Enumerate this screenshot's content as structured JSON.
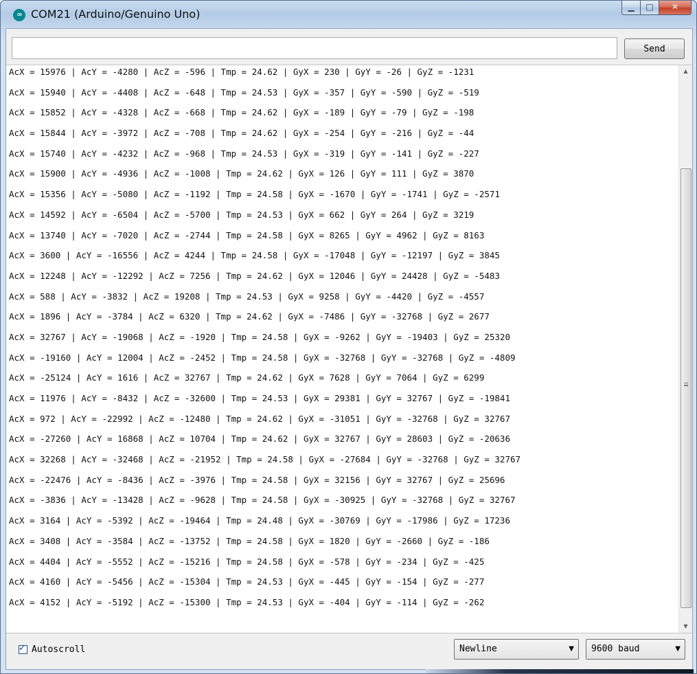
{
  "window": {
    "title": "COM21 (Arduino/Genuino Uno)",
    "app_icon_glyph": "∞",
    "minimize_glyph": "▁",
    "maximize_glyph": "□",
    "close_glyph": "✕"
  },
  "toolbar": {
    "input_value": "",
    "send_label": "Send"
  },
  "output": {
    "lines": [
      "AcX = 15976 | AcY = -4280 | AcZ = -596 | Tmp = 24.62 | GyX = 230 | GyY = -26 | GyZ = -1231",
      "AcX = 15940 | AcY = -4408 | AcZ = -648 | Tmp = 24.53 | GyX = -357 | GyY = -590 | GyZ = -519",
      "AcX = 15852 | AcY = -4328 | AcZ = -668 | Tmp = 24.62 | GyX = -189 | GyY = -79 | GyZ = -198",
      "AcX = 15844 | AcY = -3972 | AcZ = -708 | Tmp = 24.62 | GyX = -254 | GyY = -216 | GyZ = -44",
      "AcX = 15740 | AcY = -4232 | AcZ = -968 | Tmp = 24.53 | GyX = -319 | GyY = -141 | GyZ = -227",
      "AcX = 15900 | AcY = -4936 | AcZ = -1008 | Tmp = 24.62 | GyX = 126 | GyY = 111 | GyZ = 3870",
      "AcX = 15356 | AcY = -5080 | AcZ = -1192 | Tmp = 24.58 | GyX = -1670 | GyY = -1741 | GyZ = -2571",
      "AcX = 14592 | AcY = -6504 | AcZ = -5700 | Tmp = 24.53 | GyX = 662 | GyY = 264 | GyZ = 3219",
      "AcX = 13740 | AcY = -7020 | AcZ = -2744 | Tmp = 24.58 | GyX = 8265 | GyY = 4962 | GyZ = 8163",
      "AcX = 3600 | AcY = -16556 | AcZ = 4244 | Tmp = 24.58 | GyX = -17048 | GyY = -12197 | GyZ = 3845",
      "AcX = 12248 | AcY = -12292 | AcZ = 7256 | Tmp = 24.62 | GyX = 12046 | GyY = 24428 | GyZ = -5483",
      "AcX = 588 | AcY = -3832 | AcZ = 19208 | Tmp = 24.53 | GyX = 9258 | GyY = -4420 | GyZ = -4557",
      "AcX = 1896 | AcY = -3784 | AcZ = 6320 | Tmp = 24.62 | GyX = -7486 | GyY = -32768 | GyZ = 2677",
      "AcX = 32767 | AcY = -19068 | AcZ = -1920 | Tmp = 24.58 | GyX = -9262 | GyY = -19403 | GyZ = 25320",
      "AcX = -19160 | AcY = 12004 | AcZ = -2452 | Tmp = 24.58 | GyX = -32768 | GyY = -32768 | GyZ = -4809",
      "AcX = -25124 | AcY = 1616 | AcZ = 32767 | Tmp = 24.62 | GyX = 7628 | GyY = 7064 | GyZ = 6299",
      "AcX = 11976 | AcY = -8432 | AcZ = -32600 | Tmp = 24.53 | GyX = 29381 | GyY = 32767 | GyZ = -19841",
      "AcX = 972 | AcY = -22992 | AcZ = -12480 | Tmp = 24.62 | GyX = -31051 | GyY = -32768 | GyZ = 32767",
      "AcX = -27260 | AcY = 16868 | AcZ = 10704 | Tmp = 24.62 | GyX = 32767 | GyY = 28603 | GyZ = -20636",
      "AcX = 32268 | AcY = -32468 | AcZ = -21952 | Tmp = 24.58 | GyX = -27684 | GyY = -32768 | GyZ = 32767",
      "AcX = -22476 | AcY = -8436 | AcZ = -3976 | Tmp = 24.58 | GyX = 32156 | GyY = 32767 | GyZ = 25696",
      "AcX = -3836 | AcY = -13428 | AcZ = -9628 | Tmp = 24.58 | GyX = -30925 | GyY = -32768 | GyZ = 32767",
      "AcX = 3164 | AcY = -5392 | AcZ = -19464 | Tmp = 24.48 | GyX = -30769 | GyY = -17986 | GyZ = 17236",
      "AcX = 3408 | AcY = -3584 | AcZ = -13752 | Tmp = 24.58 | GyX = 1820 | GyY = -2660 | GyZ = -186",
      "AcX = 4404 | AcY = -5552 | AcZ = -15216 | Tmp = 24.58 | GyX = -578 | GyY = -234 | GyZ = -425",
      "AcX = 4160 | AcY = -5456 | AcZ = -15304 | Tmp = 24.53 | GyX = -445 | GyY = -154 | GyZ = -277",
      "AcX = 4152 | AcY = -5192 | AcZ = -15300 | Tmp = 24.53 | GyX = -404 | GyY = -114 | GyZ = -262"
    ]
  },
  "scrollbar": {
    "up_glyph": "▲",
    "down_glyph": "▼"
  },
  "status": {
    "autoscroll_label": "Autoscroll",
    "autoscroll_checked": true,
    "check_glyph": "✓",
    "line_ending": "Newline",
    "baud_rate": "9600 baud",
    "dropdown_glyph": "▼"
  },
  "icons": {
    "app": "arduino-logo-icon",
    "minimize": "minimize-icon",
    "maximize": "maximize-icon",
    "close": "close-icon",
    "scroll_up": "arrow-up-icon",
    "scroll_down": "arrow-down-icon",
    "dropdown": "chevron-down-icon",
    "check": "checkmark-icon"
  },
  "colors": {
    "titlebar": "#b9cfe8",
    "close_button": "#c9452c",
    "arduino_teal": "#00878f",
    "output_background": "#ffffff"
  }
}
